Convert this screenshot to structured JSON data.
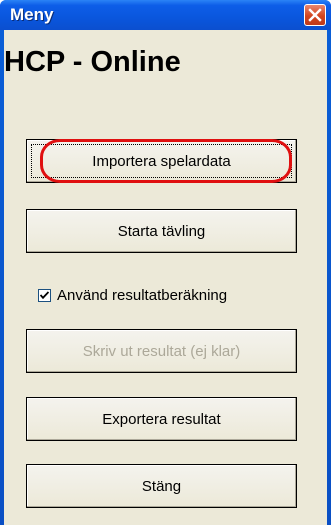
{
  "window": {
    "title": "Meny",
    "close_icon": "close-icon"
  },
  "heading": "HCP - Online",
  "buttons": {
    "import": "Importera spelardata",
    "start": "Starta tävling",
    "print": "Skriv ut resultat (ej klar)",
    "export": "Exportera resultat",
    "close": "Stäng"
  },
  "checkbox": {
    "label": "Använd resultatberäkning",
    "checked": true
  },
  "colors": {
    "titlebar": "#0a56dd",
    "dialog_bg": "#ece9d8",
    "annotation": "#e01010",
    "disabled_text": "#aca899"
  }
}
